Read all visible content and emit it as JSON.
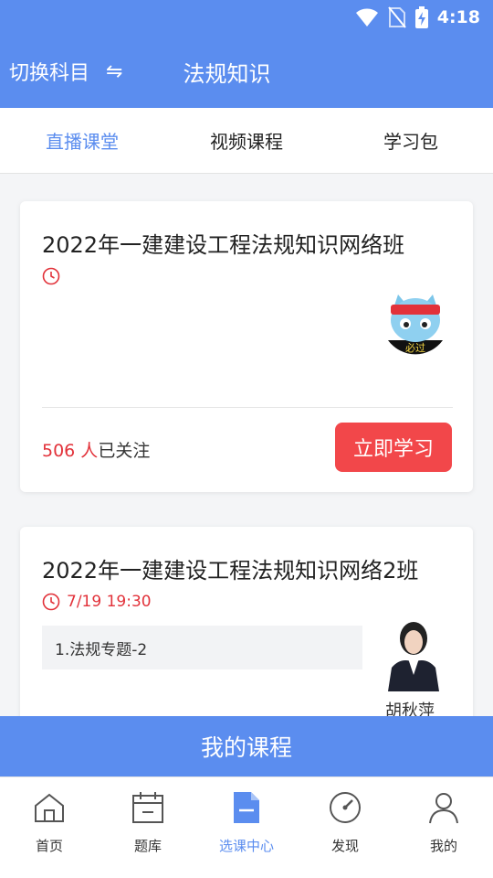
{
  "status_bar": {
    "time": "4:18"
  },
  "header": {
    "switch_label": "切换科目",
    "swap_icon": "⇋",
    "title": "法规知识"
  },
  "tabs": [
    {
      "label": "直播课堂",
      "active": true
    },
    {
      "label": "视频课程",
      "active": false
    },
    {
      "label": "学习包",
      "active": false
    }
  ],
  "courses": [
    {
      "title": "2022年一建建设工程法规知识网络班",
      "date": "",
      "logo_text": "必过",
      "followers_count": "506 人",
      "followers_suffix": "已关注",
      "button_label": "立即学习"
    },
    {
      "title": "2022年一建建设工程法规知识网络2班",
      "date": "7/19 19:30",
      "lesson": "1.法规专题-2",
      "teacher_name": "胡秋萍"
    }
  ],
  "my_courses_label": "我的课程",
  "bottom_nav": [
    {
      "label": "首页",
      "icon": "home-icon",
      "active": false
    },
    {
      "label": "题库",
      "icon": "calendar-icon",
      "active": false
    },
    {
      "label": "选课中心",
      "icon": "document-icon",
      "active": true
    },
    {
      "label": "发现",
      "icon": "compass-icon",
      "active": false
    },
    {
      "label": "我的",
      "icon": "user-icon",
      "active": false
    }
  ],
  "colors": {
    "primary": "#5b8def",
    "accent_red": "#e2323a",
    "button_red": "#f2474a"
  }
}
